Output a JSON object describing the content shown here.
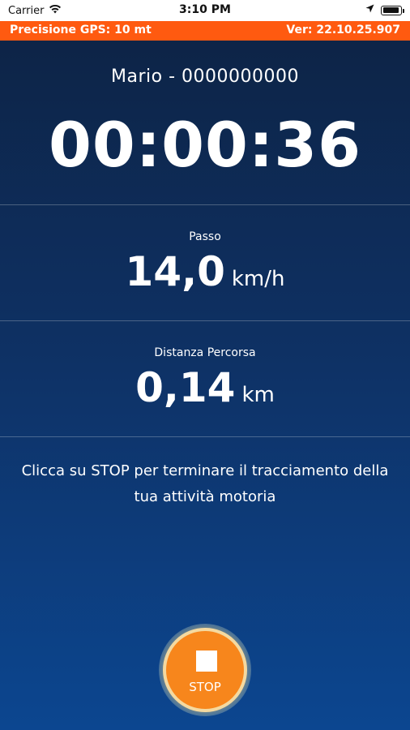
{
  "status_bar": {
    "carrier": "Carrier",
    "time": "3:10 PM",
    "icons": [
      "wifi-icon",
      "location-arrow-icon",
      "battery-icon"
    ]
  },
  "gps_bar": {
    "precision": "Precisione GPS: 10 mt",
    "version": "Ver: 22.10.25.907",
    "color": "#ff5a10"
  },
  "session": {
    "user": "Mario - 0000000000",
    "elapsed": "00:00:36"
  },
  "metrics": [
    {
      "label": "Passo",
      "value": "14,0",
      "unit": "km/h"
    },
    {
      "label": "Distanza Percorsa",
      "value": "0,14",
      "unit": "km"
    }
  ],
  "instruction": "Clicca su STOP per terminare il tracciamento della tua attività motoria",
  "stop_button": {
    "label": "STOP",
    "icon": "stop-square-icon",
    "color": "#f7861c"
  }
}
